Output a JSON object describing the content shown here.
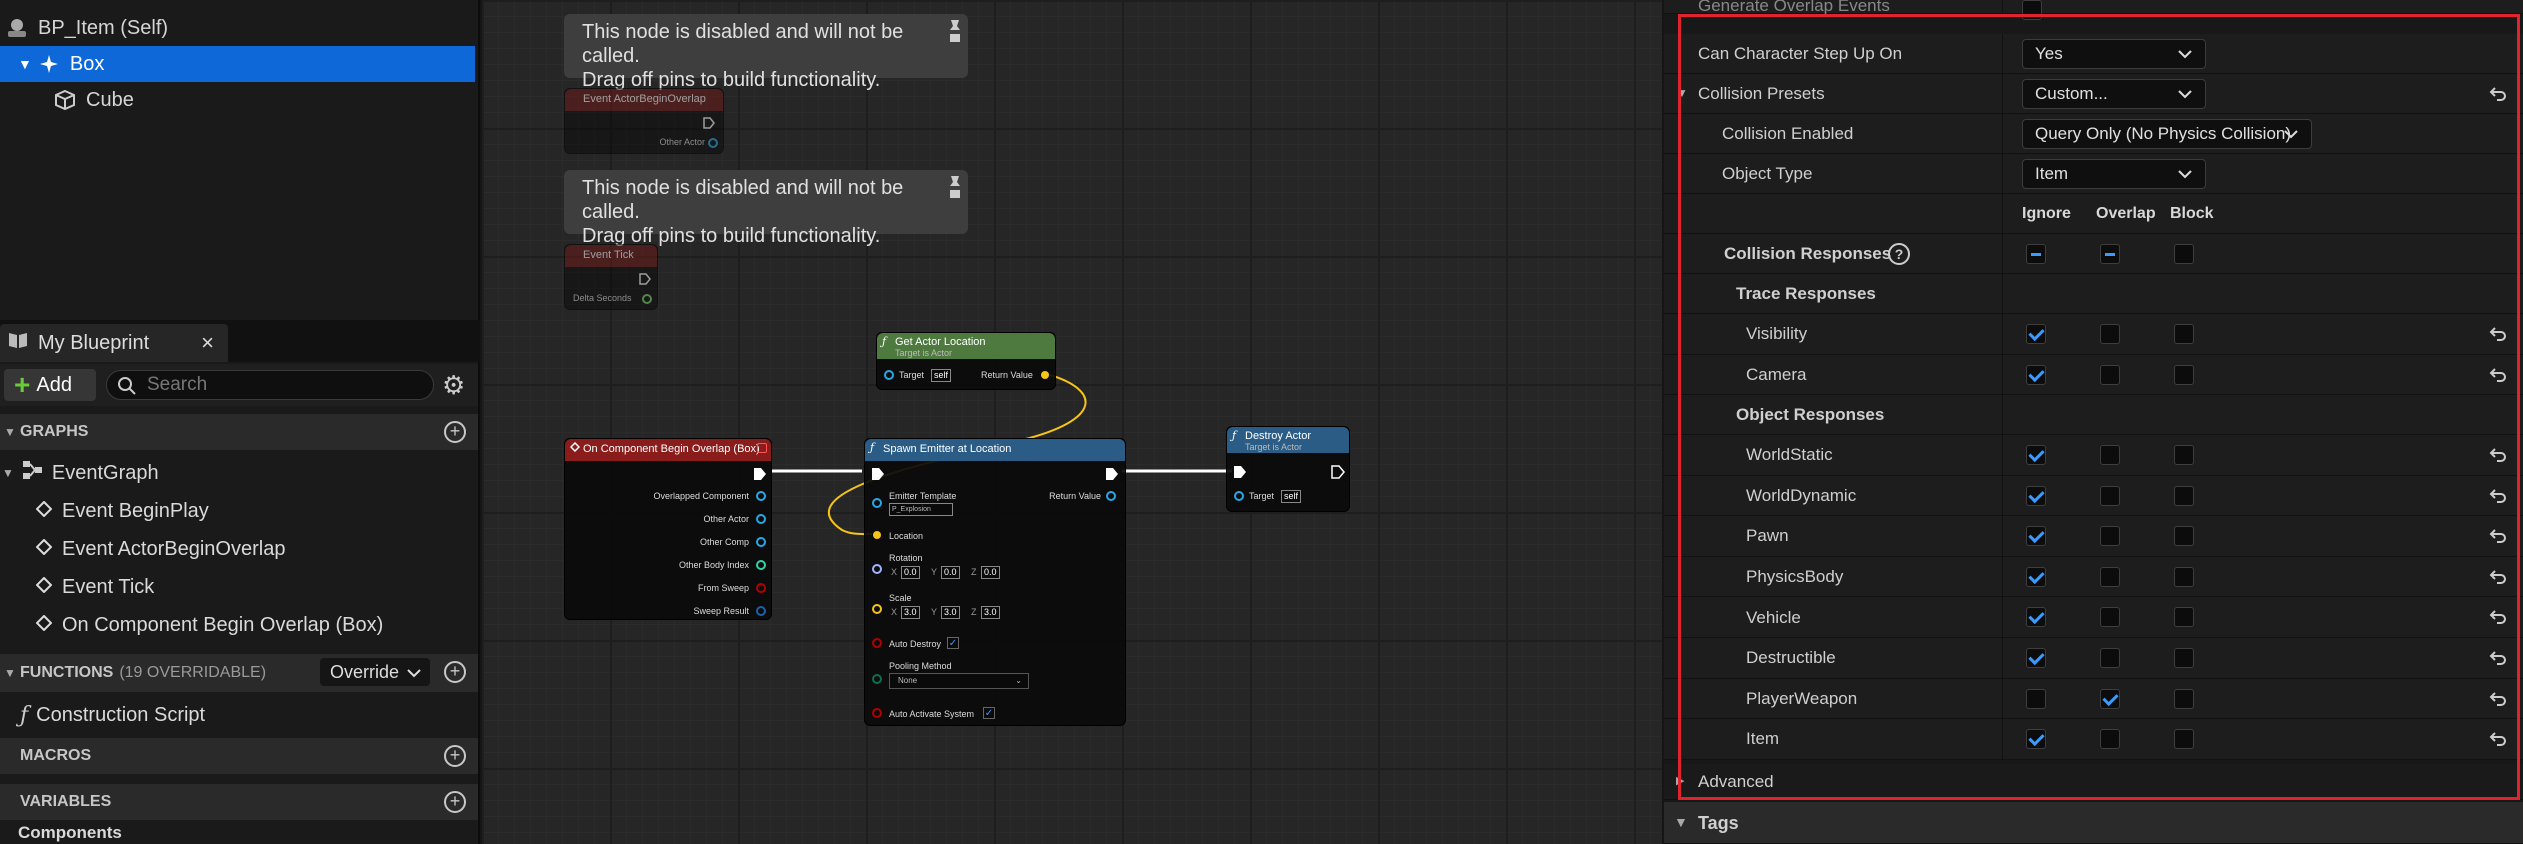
{
  "components": {
    "root": "BP_Item (Self)",
    "box": "Box",
    "cube": "Cube"
  },
  "my_blueprint": {
    "tab_label": "My Blueprint",
    "add_label": "Add",
    "search_placeholder": "Search",
    "graphs": {
      "header": "GRAPHS",
      "event_graph": "EventGraph",
      "events": [
        "Event BeginPlay",
        "Event ActorBeginOverlap",
        "Event Tick",
        "On Component Begin Overlap (Box)"
      ]
    },
    "functions": {
      "header": "FUNCTIONS",
      "overridable": "(19 OVERRIDABLE)",
      "override_label": "Override",
      "items": [
        "Construction Script"
      ]
    },
    "macros_header": "MACROS",
    "variables_header": "VARIABLES",
    "components_label": "Components"
  },
  "graph": {
    "comment_line1": "This node is disabled and will not be called.",
    "comment_line2": "Drag off pins to build functionality.",
    "actor_begin_overlap": {
      "title": "Event ActorBeginOverlap",
      "pin": "Other Actor"
    },
    "event_tick": {
      "title": "Event Tick",
      "pin": "Delta Seconds"
    },
    "get_actor_location": {
      "title": "Get Actor Location",
      "subtitle": "Target is Actor",
      "target": "Target",
      "self": "self",
      "return": "Return Value"
    },
    "on_component_begin_overlap": {
      "title": "On Component Begin Overlap (Box)",
      "pins": [
        "Overlapped Component",
        "Other Actor",
        "Other Comp",
        "Other Body Index",
        "From Sweep",
        "Sweep Result"
      ]
    },
    "spawn_emitter": {
      "title": "Spawn Emitter at Location",
      "emitter_template": "Emitter Template",
      "emitter_value": "P_Explosion",
      "return": "Return Value",
      "location": "Location",
      "rotation": "Rotation",
      "rot": [
        "0.0",
        "0.0",
        "0.0"
      ],
      "scale": "Scale",
      "scl": [
        "3.0",
        "3.0",
        "3.0"
      ],
      "axes": [
        "X",
        "Y",
        "Z"
      ],
      "auto_destroy": "Auto Destroy",
      "pooling_method": "Pooling Method",
      "pooling_value": "None",
      "auto_activate": "Auto Activate System"
    },
    "destroy_actor": {
      "title": "Destroy Actor",
      "subtitle": "Target is Actor",
      "target": "Target",
      "self": "self"
    }
  },
  "details": {
    "top_partial": "Generate Overlap Events",
    "step_up_label": "Can Character Step Up On",
    "step_up_value": "Yes",
    "presets_label": "Collision Presets",
    "presets_value": "Custom...",
    "enabled_label": "Collision Enabled",
    "enabled_value": "Query Only (No Physics Collision)",
    "object_type_label": "Object Type",
    "object_type_value": "Item",
    "col_ignore": "Ignore",
    "col_overlap": "Overlap",
    "col_block": "Block",
    "responses_label": "Collision Responses",
    "trace_label": "Trace Responses",
    "object_label": "Object Responses",
    "trace": [
      {
        "name": "Visibility",
        "ignore": true,
        "overlap": false,
        "block": false
      },
      {
        "name": "Camera",
        "ignore": true,
        "overlap": false,
        "block": false
      }
    ],
    "objects": [
      {
        "name": "WorldStatic",
        "ignore": true,
        "overlap": false,
        "block": false
      },
      {
        "name": "WorldDynamic",
        "ignore": true,
        "overlap": false,
        "block": false
      },
      {
        "name": "Pawn",
        "ignore": true,
        "overlap": false,
        "block": false
      },
      {
        "name": "PhysicsBody",
        "ignore": true,
        "overlap": false,
        "block": false
      },
      {
        "name": "Vehicle",
        "ignore": true,
        "overlap": false,
        "block": false
      },
      {
        "name": "Destructible",
        "ignore": true,
        "overlap": false,
        "block": false
      },
      {
        "name": "PlayerWeapon",
        "ignore": false,
        "overlap": true,
        "block": false
      },
      {
        "name": "Item",
        "ignore": true,
        "overlap": false,
        "block": false
      }
    ],
    "advanced_label": "Advanced",
    "tags_label": "Tags"
  },
  "colors": {
    "selection": "#0e68d8",
    "highlight": "#e0232c",
    "check": "#3a9bff",
    "event_header": "#8a1c1c",
    "function_header": "#2a5c86",
    "pure_header": "#4f7a3f"
  }
}
